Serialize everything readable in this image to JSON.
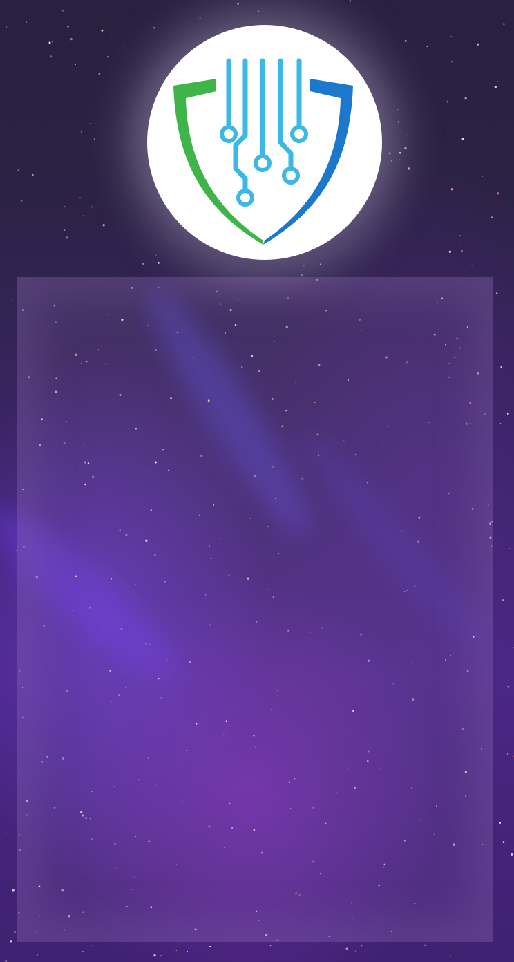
{
  "logo": {
    "icon": "shield-circuit-icon",
    "colors": {
      "green": "#3fb549",
      "blue": "#1b7fd1",
      "light_blue": "#3cb8e6",
      "circle": "#ffffff"
    }
  },
  "background": {
    "colors": [
      "#2a2140",
      "#3a2463",
      "#4b2784"
    ],
    "panel_tint": "#a082c8"
  }
}
